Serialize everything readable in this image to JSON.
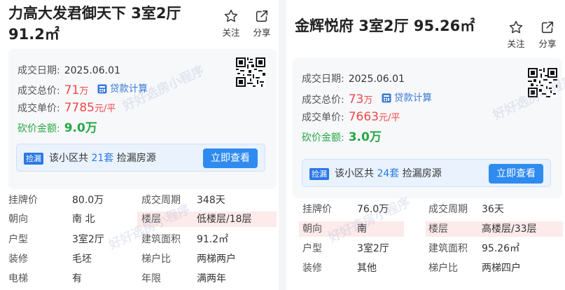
{
  "left": {
    "title": "力高大发君御天下 3室2厅 91.2㎡",
    "actions": {
      "follow": "关注",
      "share": "分享"
    },
    "deal_date_label": "成交日期:",
    "deal_date": "2025.06.01",
    "total_label": "成交总价:",
    "total_value": "71",
    "total_unit": "万",
    "loan_calc": "贷款计算",
    "unit_label": "成交单价:",
    "unit_value": "7785",
    "unit_suffix": "元/平",
    "bargain_label": "砍价金额:",
    "bargain_value": "9.0万",
    "promo": {
      "tag": "捡漏",
      "prefix": "该小区共",
      "count": "21套",
      "suffix": "捡漏房源",
      "button": "立即查看"
    },
    "details": [
      {
        "l1": "挂牌价",
        "v1": "80.0万",
        "l2": "成交周期",
        "v2": "348天"
      },
      {
        "l1": "朝向",
        "v1": "南 北",
        "l2": "楼层",
        "v2": "低楼层/18层"
      },
      {
        "l1": "户型",
        "v1": "3室2厅",
        "l2": "建筑面积",
        "v2": "91.2㎡"
      },
      {
        "l1": "装修",
        "v1": "毛坯",
        "l2": "梯户比",
        "v2": "两梯两户"
      },
      {
        "l1": "电梯",
        "v1": "有",
        "l2": "年限",
        "v2": "满两年"
      }
    ],
    "watermark": "好好选房小程序"
  },
  "right": {
    "title": "金辉悦府 3室2厅 95.26㎡",
    "actions": {
      "follow": "关注",
      "share": "分享"
    },
    "deal_date_label": "成交日期:",
    "deal_date": "2025.06.01",
    "total_label": "成交总价:",
    "total_value": "73",
    "total_unit": "万",
    "loan_calc": "贷款计算",
    "unit_label": "成交单价:",
    "unit_value": "7663",
    "unit_suffix": "元/平",
    "bargain_label": "砍价金额:",
    "bargain_value": "3.0万",
    "promo": {
      "tag": "捡漏",
      "prefix": "该小区共",
      "count": "24套",
      "suffix": "捡漏房源",
      "button": "立即查看"
    },
    "details": [
      {
        "l1": "挂牌价",
        "v1": "76.0万",
        "l2": "成交周期",
        "v2": "36天"
      },
      {
        "l1": "朝向",
        "v1": "南",
        "l2": "楼层",
        "v2": "高楼层/33层"
      },
      {
        "l1": "户型",
        "v1": "3室2厅",
        "l2": "建筑面积",
        "v2": "95.26㎡"
      },
      {
        "l1": "装修",
        "v1": "其他",
        "l2": "梯户比",
        "v2": "两梯四户"
      }
    ],
    "watermark": "好好选房小程序"
  },
  "colors": {
    "price_red": "#f04848",
    "bargain_green": "#28a745",
    "accent_blue": "#2f8bf0",
    "highlight_pink": "#fdeaea"
  },
  "icons": {
    "follow": "star-outline-icon",
    "share": "share-arrow-icon",
    "qr": "qr-code-icon",
    "calc": "calculator-icon"
  }
}
